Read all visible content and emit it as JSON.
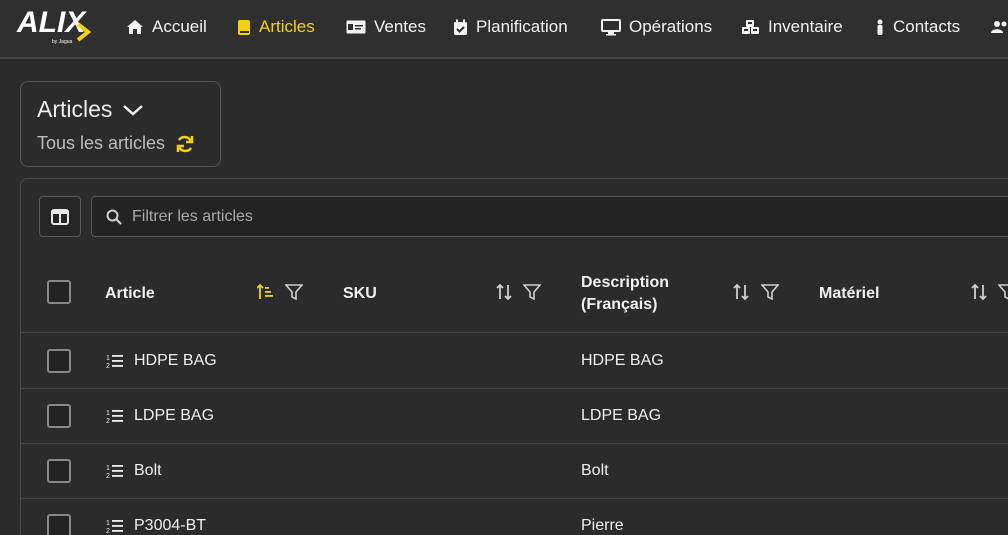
{
  "nav": {
    "items": [
      {
        "label": "Accueil",
        "icon": "home-icon"
      },
      {
        "label": "Articles",
        "icon": "book-icon",
        "active": true
      },
      {
        "label": "Ventes",
        "icon": "cash-icon"
      },
      {
        "label": "Planification",
        "icon": "calendar-check-icon"
      },
      {
        "label": "Opérations",
        "icon": "monitor-icon"
      },
      {
        "label": "Inventaire",
        "icon": "cubes-icon"
      },
      {
        "label": "Contacts",
        "icon": "person-icon"
      }
    ]
  },
  "header": {
    "title": "Articles",
    "subtitle": "Tous les articles"
  },
  "filter": {
    "placeholder": "Filtrer les articles"
  },
  "table": {
    "columns": [
      {
        "label": "Article",
        "sort": "ascending"
      },
      {
        "label": "SKU",
        "sort": "none"
      },
      {
        "label": "Description (Français)",
        "line1": "Description",
        "line2": "(Français)",
        "sort": "none"
      },
      {
        "label": "Matériel",
        "sort": "none"
      }
    ],
    "rows": [
      {
        "article": "HDPE BAG",
        "sku": "",
        "description": "HDPE BAG",
        "materiel": ""
      },
      {
        "article": "LDPE BAG",
        "sku": "",
        "description": "LDPE BAG",
        "materiel": ""
      },
      {
        "article": "Bolt",
        "sku": "",
        "description": "Bolt",
        "materiel": ""
      },
      {
        "article": "P3004-BT",
        "sku": "",
        "description": "Pierre",
        "materiel": ""
      }
    ]
  },
  "colors": {
    "accent": "#f5d10f",
    "background": "#2b2b2b",
    "text": "#e8e8e8"
  }
}
